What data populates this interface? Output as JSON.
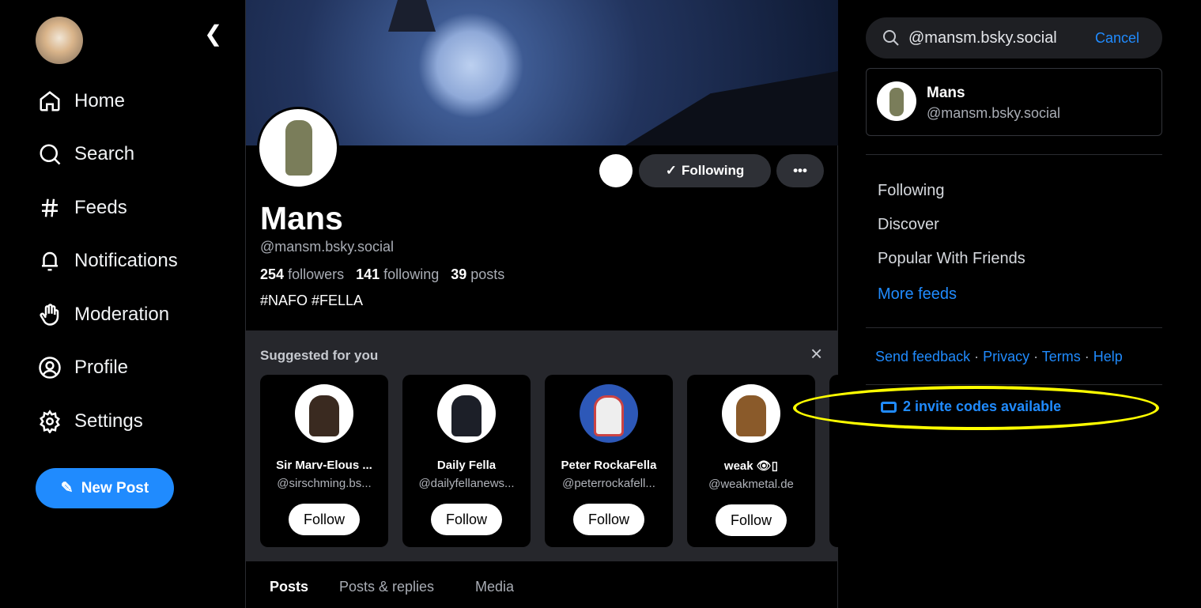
{
  "sidebar": {
    "items": [
      {
        "label": "Home",
        "icon": "home-icon"
      },
      {
        "label": "Search",
        "icon": "search-icon"
      },
      {
        "label": "Feeds",
        "icon": "hash-icon"
      },
      {
        "label": "Notifications",
        "icon": "bell-icon"
      },
      {
        "label": "Moderation",
        "icon": "hand-icon"
      },
      {
        "label": "Profile",
        "icon": "user-circle-icon"
      },
      {
        "label": "Settings",
        "icon": "gear-icon"
      }
    ],
    "new_post": "New Post"
  },
  "profile": {
    "name": "Mans",
    "handle": "@mansm.bsky.social",
    "followers_count": "254",
    "followers_label": "followers",
    "following_count": "141",
    "following_label": "following",
    "posts_count": "39",
    "posts_label": "posts",
    "bio": "#NAFO #FELLA",
    "following_button": "Following",
    "more_button": "•••"
  },
  "suggested": {
    "title": "Suggested for you",
    "close": "×",
    "cards": [
      {
        "name": "Sir Marv-Elous ...",
        "handle": "@sirschming.bs...",
        "follow": "Follow"
      },
      {
        "name": "Daily Fella",
        "handle": "@dailyfellanews...",
        "follow": "Follow"
      },
      {
        "name": "Peter RockaFella",
        "handle": "@peterrockafell...",
        "follow": "Follow"
      },
      {
        "name": "weak 👁▯",
        "handle": "@weakmetal.de",
        "follow": "Follow"
      }
    ]
  },
  "tabs": [
    "Posts",
    "Posts & replies",
    "Media"
  ],
  "right": {
    "search_value": "@mansm.bsky.social",
    "cancel": "Cancel",
    "result": {
      "name": "Mans",
      "handle": "@mansm.bsky.social"
    },
    "feeds": [
      "Following",
      "Discover",
      "Popular With Friends"
    ],
    "more_feeds": "More feeds",
    "footer": {
      "feedback": "Send feedback",
      "privacy": "Privacy",
      "terms": "Terms",
      "help": "Help",
      "sep": " · "
    },
    "invite": "2 invite codes available"
  },
  "colors": {
    "accent": "#208bfe",
    "highlight": "#ffff00"
  }
}
